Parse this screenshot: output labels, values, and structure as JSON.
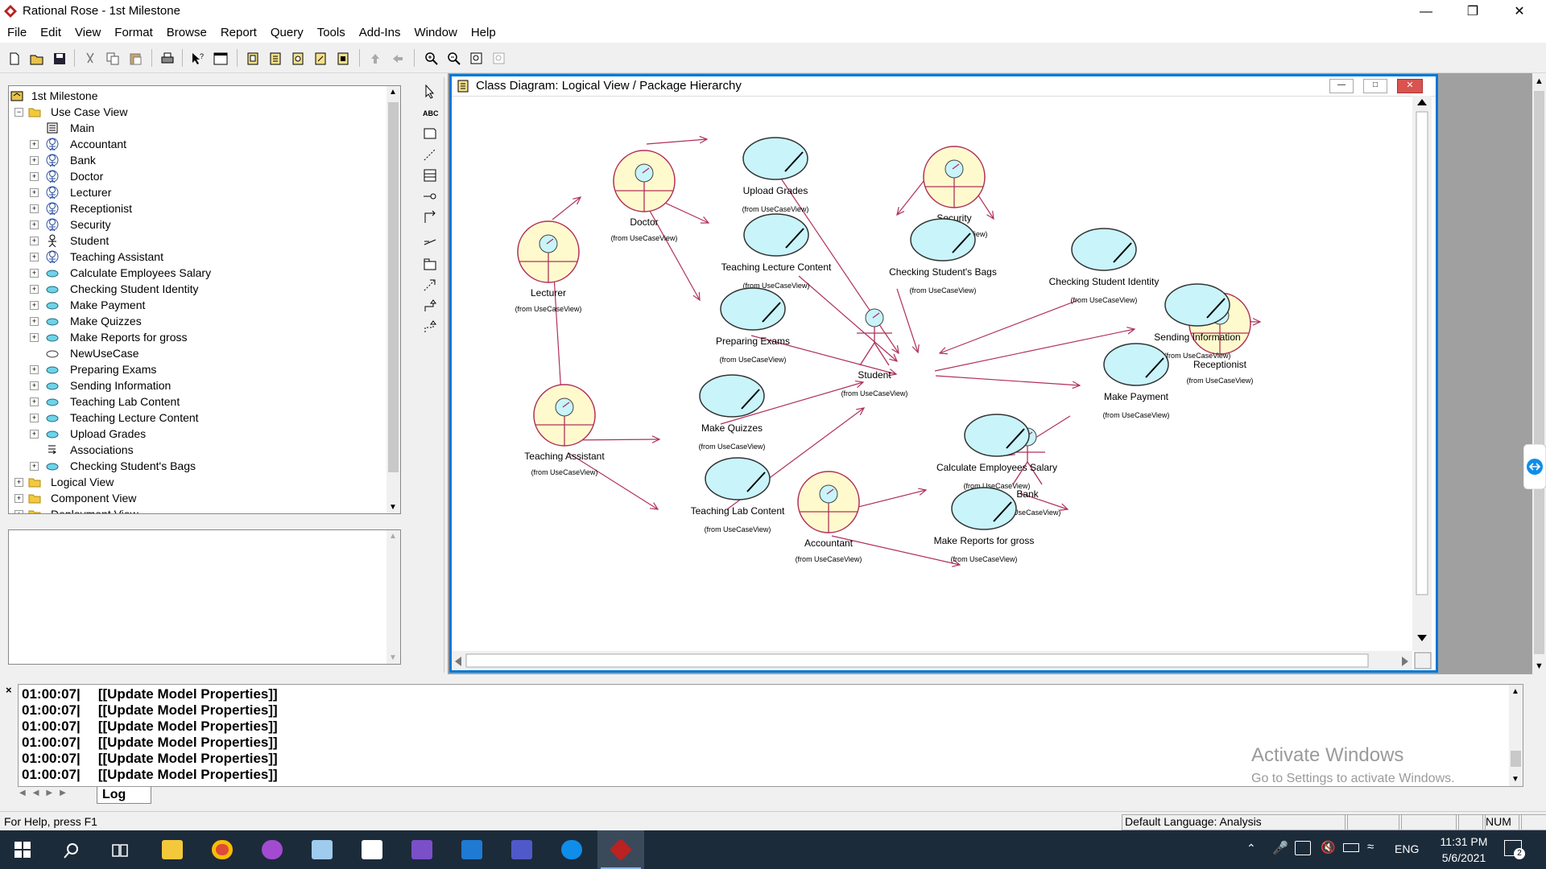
{
  "window": {
    "title": "Rational Rose - 1st Milestone"
  },
  "menu": [
    "File",
    "Edit",
    "View",
    "Format",
    "Browse",
    "Report",
    "Query",
    "Tools",
    "Add-Ins",
    "Window",
    "Help"
  ],
  "tree": {
    "root": "1st Milestone",
    "use_case_view": "Use Case View",
    "items": [
      {
        "label": "Main",
        "icon": "class-diagram-icon"
      },
      {
        "label": "Accountant",
        "icon": "actor-business-icon"
      },
      {
        "label": "Bank",
        "icon": "actor-business-icon"
      },
      {
        "label": "Doctor",
        "icon": "actor-business-icon"
      },
      {
        "label": "Lecturer",
        "icon": "actor-business-icon"
      },
      {
        "label": "Receptionist",
        "icon": "actor-business-icon"
      },
      {
        "label": "Security",
        "icon": "actor-business-icon"
      },
      {
        "label": "Student",
        "icon": "actor-icon"
      },
      {
        "label": "Teaching Assistant",
        "icon": "actor-business-icon"
      },
      {
        "label": "Calculate Employees Salary",
        "icon": "use-case-icon"
      },
      {
        "label": "Checking Student Identity",
        "icon": "use-case-icon"
      },
      {
        "label": "Make Payment",
        "icon": "use-case-icon"
      },
      {
        "label": "Make Quizzes",
        "icon": "use-case-icon"
      },
      {
        "label": "Make Reports for gross",
        "icon": "use-case-icon"
      },
      {
        "label": "NewUseCase",
        "icon": "use-case-outline-icon"
      },
      {
        "label": "Preparing Exams",
        "icon": "use-case-icon"
      },
      {
        "label": "Sending Information",
        "icon": "use-case-icon"
      },
      {
        "label": "Teaching Lab Content",
        "icon": "use-case-icon"
      },
      {
        "label": "Teaching Lecture Content",
        "icon": "use-case-icon"
      },
      {
        "label": "Upload Grades",
        "icon": "use-case-icon"
      },
      {
        "label": "Associations",
        "icon": "associations-icon"
      },
      {
        "label": "Checking Student's Bags",
        "icon": "use-case-icon"
      }
    ],
    "logical_view": "Logical View",
    "component_view": "Component View",
    "deployment_view": "Deployment View"
  },
  "diagram": {
    "title": "Class Diagram: Logical View / Package Hierarchy",
    "from_text": "(from UseCaseView)",
    "business_actors": [
      {
        "name": "Doctor"
      },
      {
        "name": "Lecturer"
      },
      {
        "name": "Security"
      },
      {
        "name": "Receptionist"
      },
      {
        "name": "Teaching Assistant"
      },
      {
        "name": "Accountant"
      }
    ],
    "actors": [
      {
        "name": "Student"
      },
      {
        "name": "Bank"
      }
    ],
    "use_cases": [
      {
        "name": "Upload Grades"
      },
      {
        "name": "Teaching Lecture Content"
      },
      {
        "name": "Preparing Exams"
      },
      {
        "name": "Checking Student's Bags"
      },
      {
        "name": "Checking Student Identity"
      },
      {
        "name": "Sending Information"
      },
      {
        "name": "Make Payment"
      },
      {
        "name": "Make Quizzes"
      },
      {
        "name": "Teaching Lab Content"
      },
      {
        "name": "Calculate Employees Salary"
      },
      {
        "name": "Make Reports for gross"
      }
    ],
    "colors": {
      "actor_fill": "#fffacd",
      "use_case_fill": "#c8f4fa",
      "line": "#b0305a"
    }
  },
  "log": {
    "lines": [
      {
        "time": "01:00:07|",
        "msg": "[[Update Model Properties]]"
      },
      {
        "time": "01:00:07|",
        "msg": "[[Update Model Properties]]"
      },
      {
        "time": "01:00:07|",
        "msg": "[[Update Model Properties]]"
      },
      {
        "time": "01:00:07|",
        "msg": "[[Update Model Properties]]"
      },
      {
        "time": "01:00:07|",
        "msg": "[[Update Model Properties]]"
      },
      {
        "time": "01:00:07|",
        "msg": "[[Update Model Properties]]"
      }
    ],
    "tab": "Log"
  },
  "watermark": {
    "line1": "Activate Windows",
    "line2": "Go to Settings to activate Windows."
  },
  "status": {
    "help": "For Help, press F1",
    "language": "Default Language: Analysis",
    "num": "NUM"
  },
  "taskbar": {
    "time": "11:31 PM",
    "date": "5/6/2021",
    "lang": "ENG",
    "notifications": "2"
  }
}
